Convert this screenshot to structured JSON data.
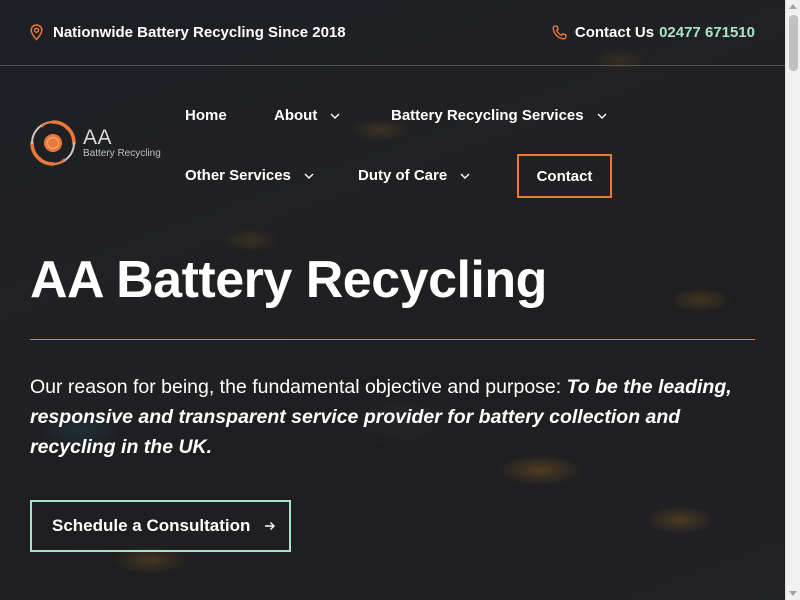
{
  "topbar": {
    "location_text": "Nationwide Battery Recycling Since 2018",
    "contact_label": "Contact Us",
    "phone": "02477 671510",
    "location_icon": "map-pin-icon",
    "phone_icon": "phone-icon"
  },
  "logo": {
    "main": "AA",
    "sub": "Battery Recycling"
  },
  "nav": {
    "items": [
      {
        "label": "Home"
      },
      {
        "label": "About"
      },
      {
        "label": "Battery Recycling Services"
      },
      {
        "label": "Other Services"
      },
      {
        "label": "Duty of Care"
      },
      {
        "label": "Contact"
      }
    ]
  },
  "hero": {
    "title": "AA Battery Recycling",
    "lead": "Our reason for being, the fundamental objective and purpose:",
    "emphasis": "To be the leading, responsive and transparent service provider for battery collection and recycling in the UK.",
    "cta_label": "Schedule a Consultation",
    "cta_icon": "arrow-right-icon"
  },
  "colors": {
    "accent_orange": "#e8793a",
    "accent_mint": "#a7e3cf",
    "overlay": "#1b1d22"
  }
}
